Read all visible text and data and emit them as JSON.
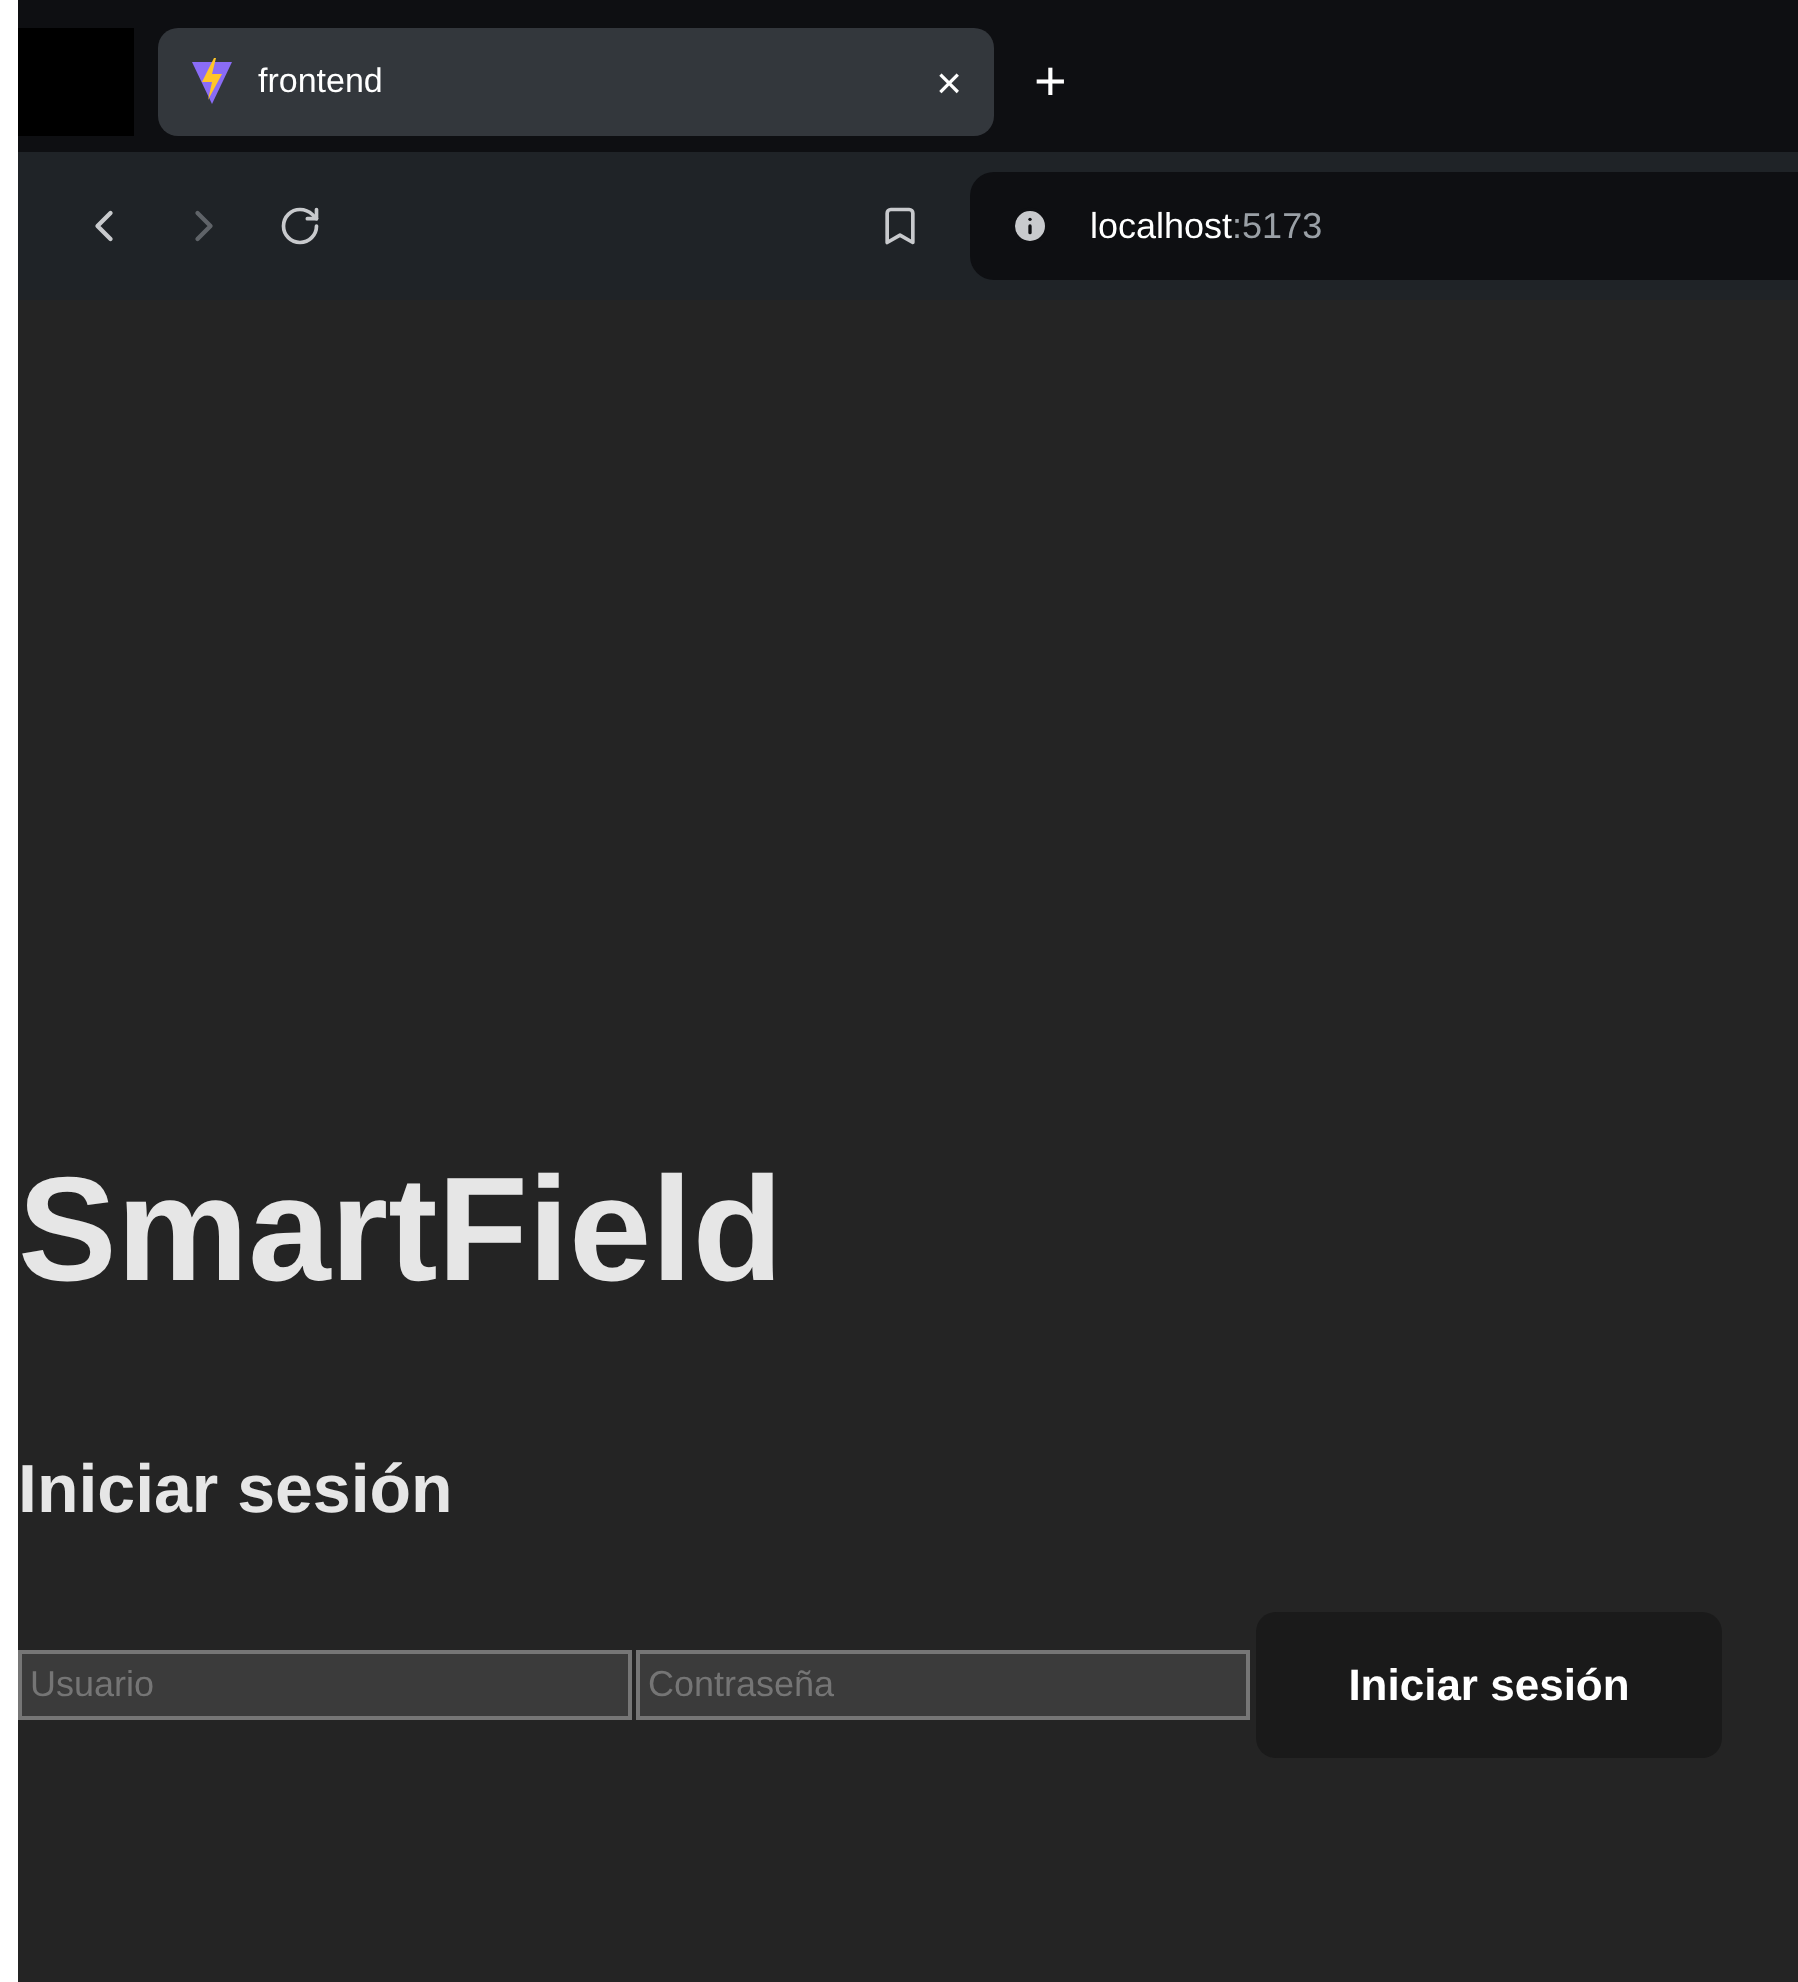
{
  "browser": {
    "tab": {
      "title": "frontend",
      "close": "×",
      "selected": true
    },
    "new_tab": "+",
    "address": {
      "host": "localhost",
      "port": ":5173"
    }
  },
  "page": {
    "title": "SmartField",
    "heading": "Iniciar sesión",
    "fields": [
      {
        "placeholder": "Usuario"
      },
      {
        "placeholder": "Contraseña"
      }
    ],
    "button": "Iniciar sesión"
  }
}
